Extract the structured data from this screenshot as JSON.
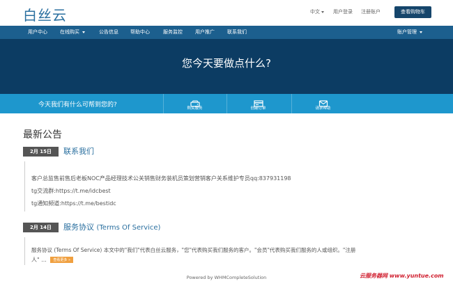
{
  "header": {
    "logo": "白丝云",
    "language": "中文",
    "login": "用户登录",
    "register": "注册账户",
    "cart_button": "查看购物车"
  },
  "nav": {
    "items": [
      "用户中心",
      "在线购买",
      "公告信息",
      "帮助中心",
      "服务监控",
      "用户推广",
      "联系我们"
    ],
    "account": "账户管理"
  },
  "hero": {
    "title": "您今天要做点什么?"
  },
  "helpbar": {
    "text": "今天我们有什么可帮到您的?",
    "actions": [
      {
        "label": "购买服务",
        "icon": "server-icon"
      },
      {
        "label": "创建订单",
        "icon": "billing-icon"
      },
      {
        "label": "请求帮助",
        "icon": "envelope-icon"
      }
    ]
  },
  "announcements": {
    "title": "最新公告",
    "items": [
      {
        "date": "2月 15日",
        "title": "联系我们",
        "lines": [
          "客户总监售前售后老板NOC产品经理技术公关销售财务装机员策划营销客户关系维护专员qq:837931198",
          "tg交流群:https://t.me/idcbest",
          "tg通知频道:https://t.me/bestidc"
        ]
      },
      {
        "date": "2月 14日",
        "title": "服务协议",
        "title_en": "(Terms Of Service)",
        "lines": [
          "服务协议 (Terms Of Service) 本文中的\"我们\"代表白丝云服务，\"您\"代表购买我们服务的客户。\"会员\"代表购买我们服务的人或组织。\"注册",
          "人\" ..."
        ],
        "read_more": "查看更多 »"
      }
    ]
  },
  "footer": {
    "text": "Powered by WHMCompleteSolution"
  },
  "watermark": "云服务器网 www.yuntue.com"
}
